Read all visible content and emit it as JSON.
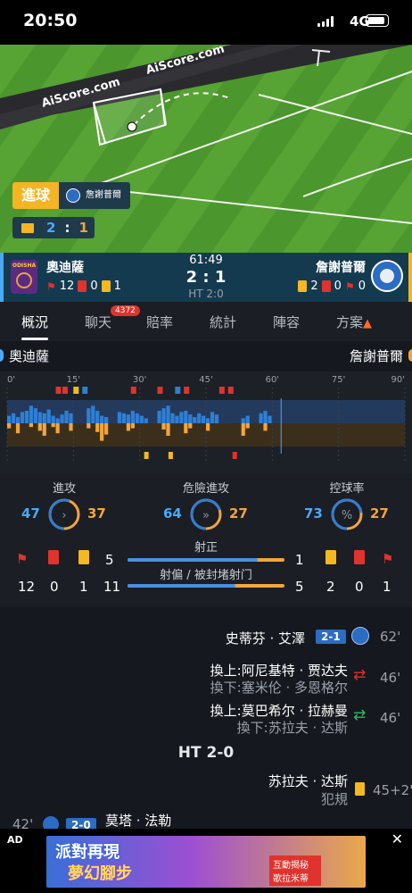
{
  "status_bar": {
    "time": "20:50",
    "network": "4G"
  },
  "pitch": {
    "watermark": "AiScore.com",
    "goal_label": "進球",
    "goal_team": "詹謝普爾",
    "mini_score": {
      "home": "2",
      "sep": ":",
      "away": "1"
    }
  },
  "match": {
    "home_team": "奧迪薩",
    "away_team": "詹謝普爾",
    "home_logo_text": "ODISHA",
    "clock": "61:49",
    "score": "2 : 1",
    "half_time": "HT 2:0",
    "home_stats": {
      "corners": "12",
      "red": "0",
      "yellow": "1"
    },
    "away_stats": {
      "yellow": "2",
      "red": "0",
      "corners": "0"
    }
  },
  "tabs": [
    {
      "label": "概況",
      "active": true
    },
    {
      "label": "聊天",
      "badge": "4372"
    },
    {
      "label": "賠率"
    },
    {
      "label": "統計"
    },
    {
      "label": "陣容"
    },
    {
      "label": "方案",
      "icon": "fire-icon"
    }
  ],
  "timeline": {
    "home_team": "奧迪薩",
    "away_team": "詹謝普爾",
    "ticks": [
      "0'",
      "15'",
      "30'",
      "45'",
      "60'",
      "75'",
      "90'"
    ],
    "current_minute": 62,
    "colors": {
      "home": "#2e7fd6",
      "away": "#f3a53c"
    }
  },
  "stats": {
    "gauges": [
      {
        "label": "進攻",
        "home": "47",
        "away": "37",
        "icon": "chevron-right-icon",
        "home_share": 0.56
      },
      {
        "label": "危險進攻",
        "home": "64",
        "away": "27",
        "icon": "double-chevron-icon",
        "home_share": 0.7
      },
      {
        "label": "控球率",
        "home": "73",
        "away": "27",
        "icon": "percent-icon",
        "home_share": 0.73
      }
    ],
    "on_target": {
      "label": "射正",
      "home": "5",
      "away": "1",
      "home_share": 0.83
    },
    "off_target": {
      "label": "射偏 / 被封堵射门",
      "home": "11",
      "away": "5",
      "home_share": 0.69
    },
    "home_row": {
      "corners": "12",
      "red": "0",
      "yellow": "1"
    },
    "away_row": {
      "yellow": "2",
      "red": "0",
      "corners": "1"
    }
  },
  "events": [
    {
      "type": "goal",
      "player": "史蒂芬 · 艾澤",
      "score": "2-1",
      "minute": "62'"
    },
    {
      "type": "sub",
      "in": "換上:阿尼基特 · 贾达夫",
      "out": "換下:塞米伦 · 多恩格尔",
      "minute": "46'"
    },
    {
      "type": "sub",
      "in": "換上:莫巴希尔 · 拉赫曼",
      "out": "換下:苏拉夫 · 达斯",
      "minute": "46'"
    },
    {
      "type": "divider",
      "label": "HT 2-0"
    },
    {
      "type": "yellow",
      "player": "苏拉夫 · 达斯",
      "detail": "犯規",
      "minute": "45+2'"
    },
    {
      "type": "goal_home",
      "player": "莫塔 · 法勒",
      "score": "2-0",
      "minute": "42'"
    }
  ],
  "ad": {
    "label": "AD",
    "line1": "派對再現",
    "line2": "夢幻腳步",
    "tag": "互動揭秘 歌拉米蒂"
  }
}
